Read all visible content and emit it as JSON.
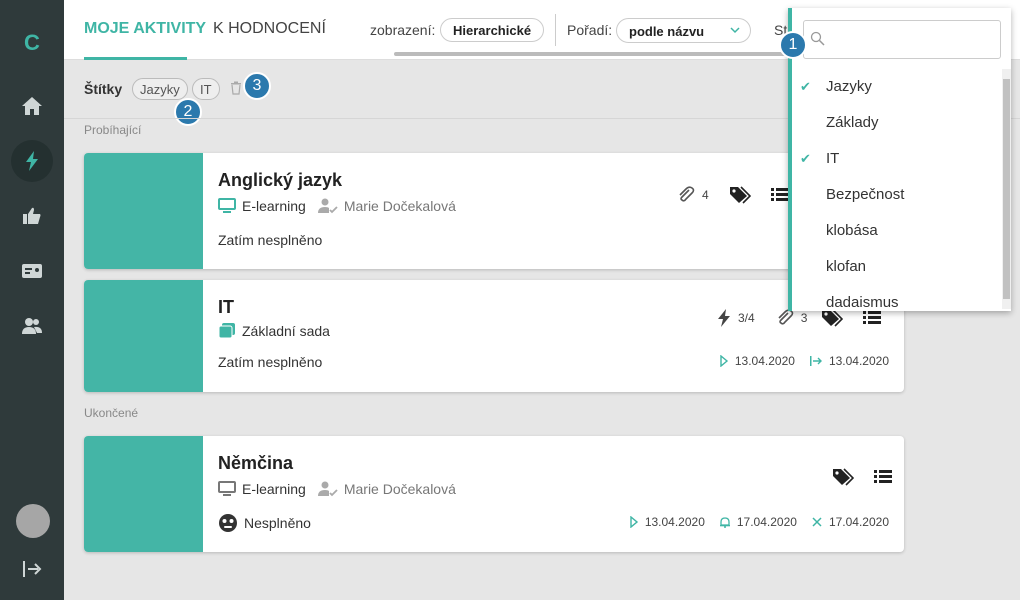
{
  "app": {
    "logo": "C"
  },
  "header": {
    "tabs": [
      {
        "label": "MOJE AKTIVITY",
        "active": true
      },
      {
        "label": "K HODNOCENÍ",
        "active": false
      }
    ],
    "view_label": "zobrazení:",
    "view_value": "Hierarchické",
    "order_label": "Pořadí:",
    "order_value": "podle názvu",
    "cut_label": "St"
  },
  "tags": {
    "label": "Štítky",
    "chips": [
      "Jazyky",
      "IT"
    ]
  },
  "badges": [
    "1",
    "2",
    "3"
  ],
  "sections": {
    "ongoing": "Probíhající",
    "finished": "Ukončené"
  },
  "cards": [
    {
      "title": "Anglický jazyk",
      "type": "E-learning",
      "author": "Marie Dočekalová",
      "status": "Zatím nesplněno",
      "attachments": "4"
    },
    {
      "title": "IT",
      "type": "Základní sada",
      "status": "Zatím nesplněno",
      "progress": "3/4",
      "attachments": "3",
      "start_date": "13.04.2020",
      "end_date": "13.04.2020"
    },
    {
      "title": "Němčina",
      "type": "E-learning",
      "author": "Marie Dočekalová",
      "status": "Nesplněno",
      "start_date": "13.04.2020",
      "reminder_date": "17.04.2020",
      "deadline_date": "17.04.2020"
    }
  ],
  "dropdown": {
    "search_placeholder": "",
    "items": [
      {
        "label": "Jazyky",
        "checked": true
      },
      {
        "label": "Základy",
        "checked": false
      },
      {
        "label": "IT",
        "checked": true
      },
      {
        "label": "Bezpečnost",
        "checked": false
      },
      {
        "label": "klobása",
        "checked": false
      },
      {
        "label": "klofan",
        "checked": false
      },
      {
        "label": "dadaismus",
        "checked": false
      }
    ]
  },
  "colors": {
    "accent": "#3fb5a5",
    "sidebar": "#2f3a3b",
    "badge": "#2b79ad"
  }
}
